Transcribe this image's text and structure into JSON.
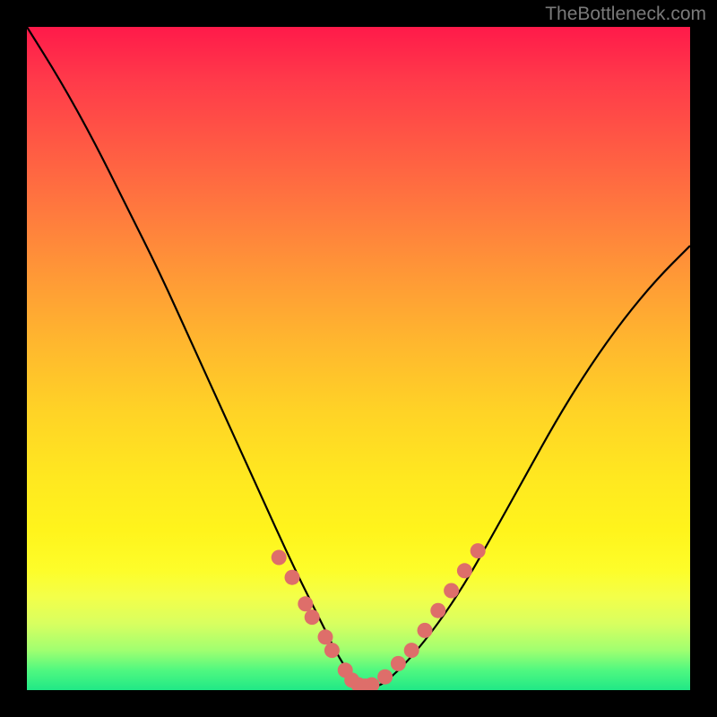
{
  "attribution": "TheBottleneck.com",
  "chart_data": {
    "type": "line",
    "title": "",
    "xlabel": "",
    "ylabel": "",
    "xlim": [
      0,
      100
    ],
    "ylim": [
      0,
      100
    ],
    "series": [
      {
        "name": "bottleneck-curve",
        "x": [
          0,
          5,
          10,
          15,
          20,
          25,
          30,
          35,
          40,
          45,
          47,
          49,
          51,
          53,
          55,
          58,
          62,
          66,
          70,
          75,
          80,
          85,
          90,
          95,
          100
        ],
        "y": [
          100,
          92,
          83,
          73,
          63,
          52,
          41,
          30,
          19,
          9,
          5,
          2,
          0.5,
          0.5,
          2,
          5,
          10,
          16,
          23,
          32,
          41,
          49,
          56,
          62,
          67
        ]
      }
    ],
    "markers": {
      "x": [
        38,
        40,
        42,
        43,
        45,
        46,
        48,
        49,
        50,
        51,
        52,
        54,
        56,
        58,
        60,
        62,
        64,
        66,
        68
      ],
      "y": [
        20,
        17,
        13,
        11,
        8,
        6,
        3,
        1.5,
        0.8,
        0.6,
        0.8,
        2,
        4,
        6,
        9,
        12,
        15,
        18,
        21
      ]
    },
    "annotations": []
  },
  "colors": {
    "curve": "#000000",
    "marker": "#de6e6a",
    "background_top": "#ff1a4a",
    "background_bottom": "#20e886"
  }
}
